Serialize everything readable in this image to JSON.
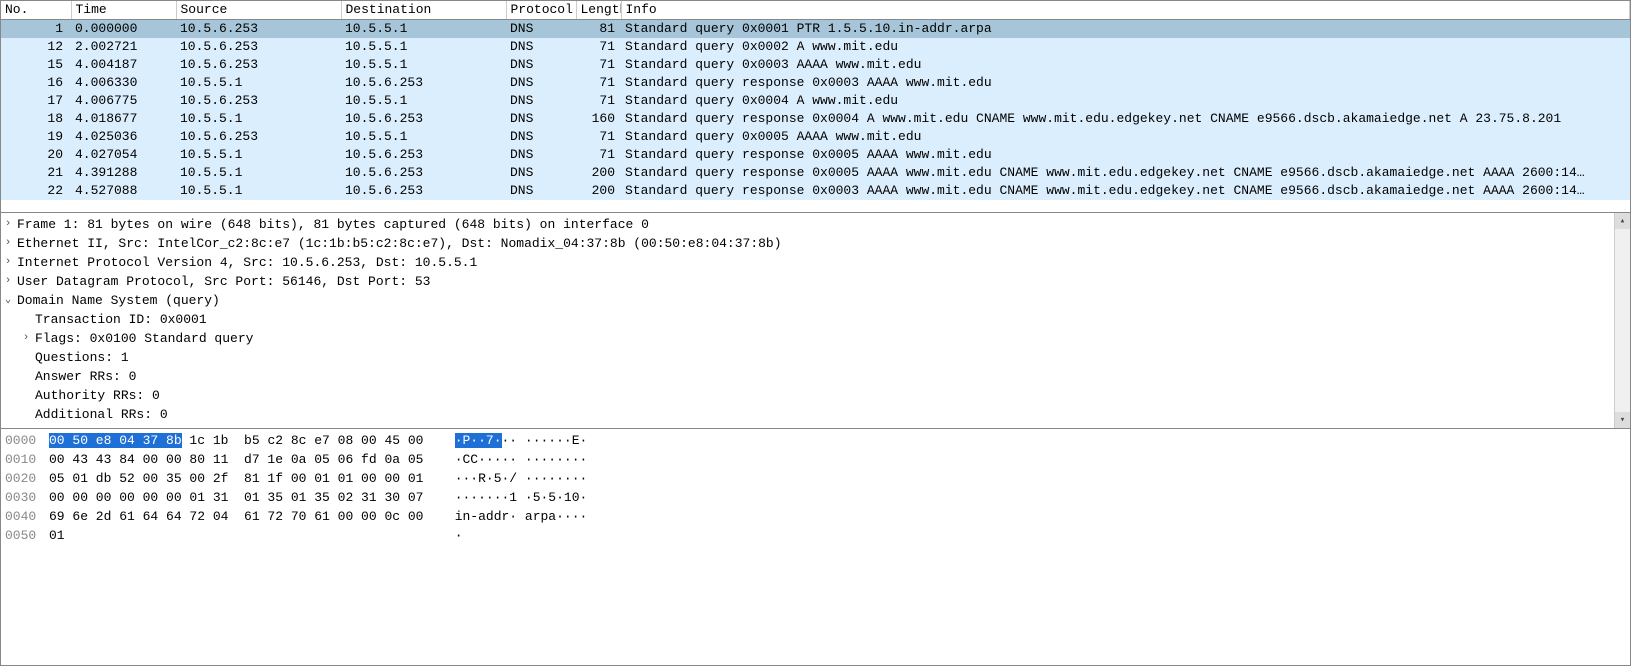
{
  "columns": {
    "no": "No.",
    "time": "Time",
    "source": "Source",
    "destination": "Destination",
    "protocol": "Protocol",
    "length": "Length",
    "info": "Info"
  },
  "packets": [
    {
      "no": "1",
      "time": "0.000000",
      "src": "10.5.6.253",
      "dst": "10.5.5.1",
      "proto": "DNS",
      "len": "81",
      "info": "Standard query 0x0001 PTR 1.5.5.10.in-addr.arpa",
      "sel": true
    },
    {
      "no": "12",
      "time": "2.002721",
      "src": "10.5.6.253",
      "dst": "10.5.5.1",
      "proto": "DNS",
      "len": "71",
      "info": "Standard query 0x0002 A www.mit.edu"
    },
    {
      "no": "15",
      "time": "4.004187",
      "src": "10.5.6.253",
      "dst": "10.5.5.1",
      "proto": "DNS",
      "len": "71",
      "info": "Standard query 0x0003 AAAA www.mit.edu"
    },
    {
      "no": "16",
      "time": "4.006330",
      "src": "10.5.5.1",
      "dst": "10.5.6.253",
      "proto": "DNS",
      "len": "71",
      "info": "Standard query response 0x0003 AAAA www.mit.edu"
    },
    {
      "no": "17",
      "time": "4.006775",
      "src": "10.5.6.253",
      "dst": "10.5.5.1",
      "proto": "DNS",
      "len": "71",
      "info": "Standard query 0x0004 A www.mit.edu"
    },
    {
      "no": "18",
      "time": "4.018677",
      "src": "10.5.5.1",
      "dst": "10.5.6.253",
      "proto": "DNS",
      "len": "160",
      "info": "Standard query response 0x0004 A www.mit.edu CNAME www.mit.edu.edgekey.net CNAME e9566.dscb.akamaiedge.net A 23.75.8.201"
    },
    {
      "no": "19",
      "time": "4.025036",
      "src": "10.5.6.253",
      "dst": "10.5.5.1",
      "proto": "DNS",
      "len": "71",
      "info": "Standard query 0x0005 AAAA www.mit.edu"
    },
    {
      "no": "20",
      "time": "4.027054",
      "src": "10.5.5.1",
      "dst": "10.5.6.253",
      "proto": "DNS",
      "len": "71",
      "info": "Standard query response 0x0005 AAAA www.mit.edu"
    },
    {
      "no": "21",
      "time": "4.391288",
      "src": "10.5.5.1",
      "dst": "10.5.6.253",
      "proto": "DNS",
      "len": "200",
      "info": "Standard query response 0x0005 AAAA www.mit.edu CNAME www.mit.edu.edgekey.net CNAME e9566.dscb.akamaiedge.net AAAA 2600:14…"
    },
    {
      "no": "22",
      "time": "4.527088",
      "src": "10.5.5.1",
      "dst": "10.5.6.253",
      "proto": "DNS",
      "len": "200",
      "info": "Standard query response 0x0003 AAAA www.mit.edu CNAME www.mit.edu.edgekey.net CNAME e9566.dscb.akamaiedge.net AAAA 2600:14…"
    }
  ],
  "details": [
    {
      "level": 0,
      "arrow": ">",
      "text": "Frame 1: 81 bytes on wire (648 bits), 81 bytes captured (648 bits) on interface 0"
    },
    {
      "level": 0,
      "arrow": ">",
      "text": "Ethernet II, Src: IntelCor_c2:8c:e7 (1c:1b:b5:c2:8c:e7), Dst: Nomadix_04:37:8b (00:50:e8:04:37:8b)"
    },
    {
      "level": 0,
      "arrow": ">",
      "text": "Internet Protocol Version 4, Src: 10.5.6.253, Dst: 10.5.5.1"
    },
    {
      "level": 0,
      "arrow": ">",
      "text": "User Datagram Protocol, Src Port: 56146, Dst Port: 53"
    },
    {
      "level": 0,
      "arrow": "v",
      "text": "Domain Name System (query)"
    },
    {
      "level": 1,
      "arrow": "",
      "text": "Transaction ID: 0x0001"
    },
    {
      "level": 1,
      "arrow": ">",
      "text": "Flags: 0x0100 Standard query"
    },
    {
      "level": 1,
      "arrow": "",
      "text": "Questions: 1"
    },
    {
      "level": 1,
      "arrow": "",
      "text": "Answer RRs: 0"
    },
    {
      "level": 1,
      "arrow": "",
      "text": "Authority RRs: 0"
    },
    {
      "level": 1,
      "arrow": "",
      "text": "Additional RRs: 0"
    }
  ],
  "hex": {
    "rows": [
      {
        "off": "0000",
        "hl": "00 50 e8 04 37 8b",
        "rest": " 1c 1b  b5 c2 8c e7 08 00 45 00",
        "ascii_pre": "",
        "ascii_hl": "·P··7·",
        "ascii_post": "·· ······E·"
      },
      {
        "off": "0010",
        "hl": "",
        "rest": "00 43 43 84 00 00 80 11  d7 1e 0a 05 06 fd 0a 05",
        "ascii_pre": "·CC····· ········",
        "ascii_hl": "",
        "ascii_post": ""
      },
      {
        "off": "0020",
        "hl": "",
        "rest": "05 01 db 52 00 35 00 2f  81 1f 00 01 01 00 00 01",
        "ascii_pre": "···R·5·/ ········",
        "ascii_hl": "",
        "ascii_post": ""
      },
      {
        "off": "0030",
        "hl": "",
        "rest": "00 00 00 00 00 00 01 31  01 35 01 35 02 31 30 07",
        "ascii_pre": "·······1 ·5·5·10·",
        "ascii_hl": "",
        "ascii_post": ""
      },
      {
        "off": "0040",
        "hl": "",
        "rest": "69 6e 2d 61 64 64 72 04  61 72 70 61 00 00 0c 00",
        "ascii_pre": "in-addr· arpa····",
        "ascii_hl": "",
        "ascii_post": ""
      },
      {
        "off": "0050",
        "hl": "",
        "rest": "01",
        "ascii_pre": "·",
        "ascii_hl": "",
        "ascii_post": ""
      }
    ]
  },
  "scroll": {
    "up": "▴",
    "down": "▾"
  }
}
